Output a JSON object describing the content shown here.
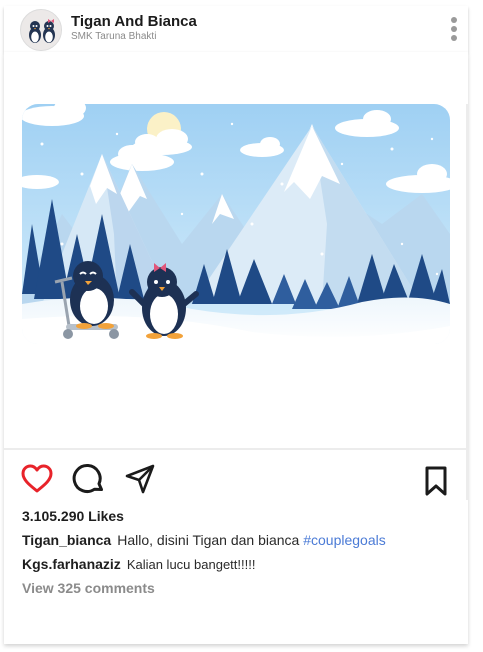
{
  "header": {
    "account_name": "Tigan And Bianca",
    "account_sub": "SMK Taruna Bhakti",
    "avatar_icon": "penguin-couple-avatar",
    "more_icon": "more-vertical-icon"
  },
  "post": {
    "image_description_icon": "winter-penguins-illustration",
    "actions": {
      "like_icon": "heart-icon",
      "comment_icon": "comment-icon",
      "share_icon": "send-icon",
      "save_icon": "bookmark-icon"
    },
    "likes": "3.105.290 Likes",
    "caption": {
      "user": "Tigan_bianca",
      "text": "Hallo, disini Tigan dan bianca",
      "hashtag": "#couplegoals"
    },
    "comment": {
      "user": "Kgs.farhanaziz",
      "text": "Kalian lucu bangett!!!!!"
    },
    "view_comments": "View 325 comments"
  },
  "colors": {
    "like_red": "#e8232a",
    "hashtag_blue": "#4b7bd6",
    "muted_gray": "#8b8b8b"
  }
}
